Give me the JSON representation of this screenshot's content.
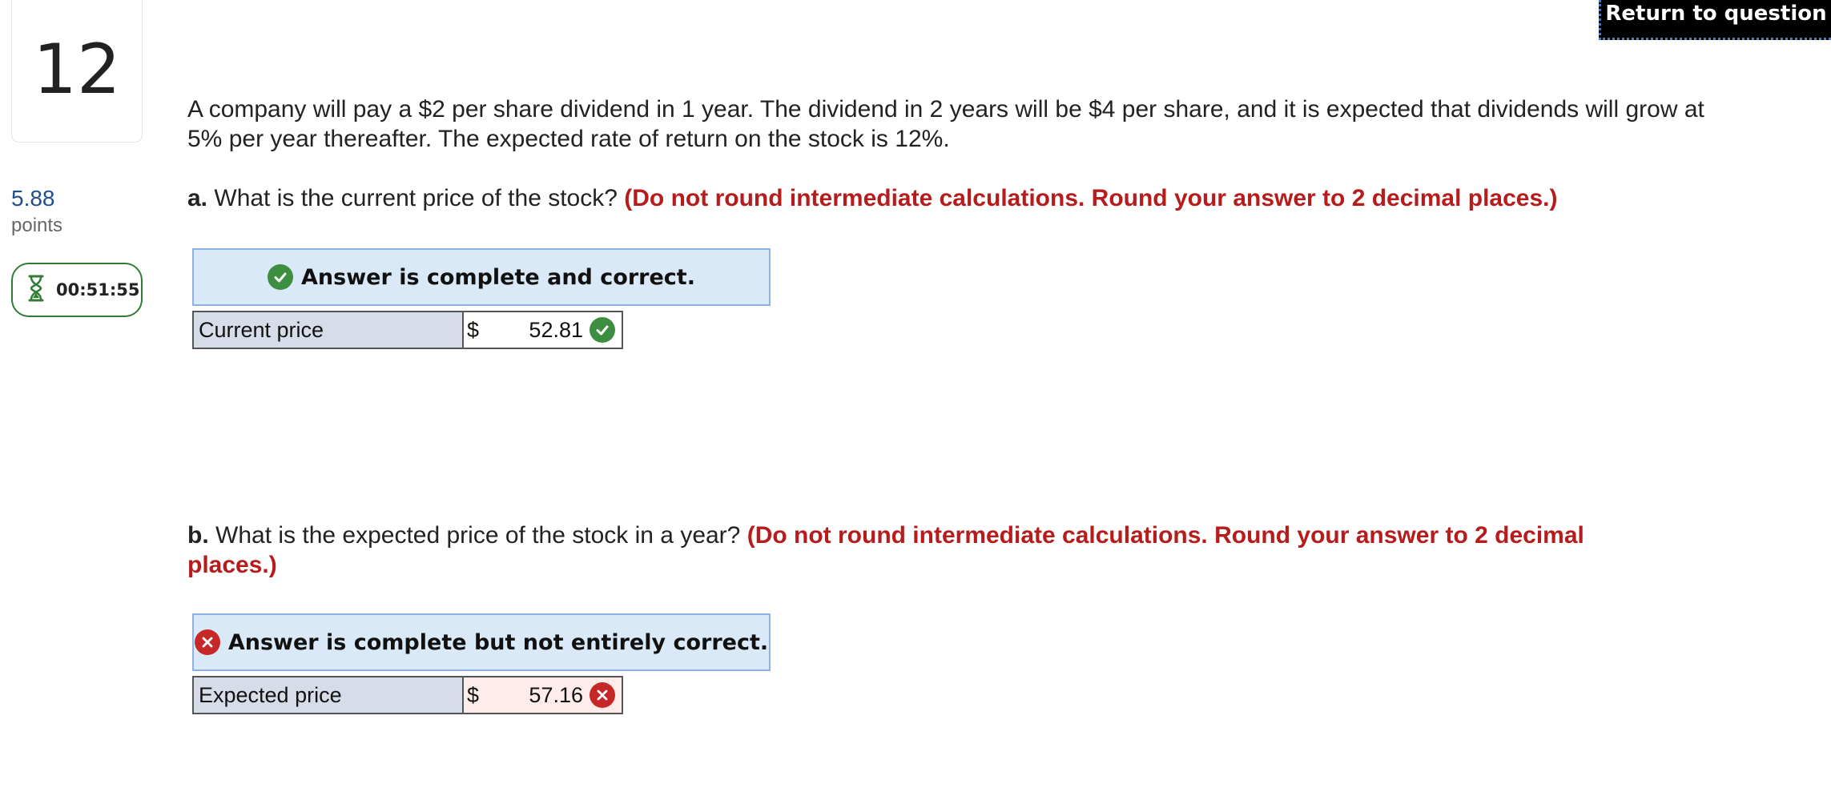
{
  "header": {
    "return_label": "Return to question"
  },
  "question": {
    "number": "12",
    "points_value": "5.88",
    "points_label": "points",
    "timer": "00:51:55",
    "prompt": "A company will pay a $2 per share dividend in 1 year. The dividend in 2 years will be $4 per share, and it is expected that dividends will grow at 5% per year thereafter. The expected rate of return on the stock is 12%."
  },
  "part_a": {
    "letter": "a.",
    "question": "What is the current price of the stock?",
    "note": "(Do not round intermediate calculations. Round your answer to 2 decimal places.)",
    "status": "Answer is complete and correct.",
    "status_icon": "check-circle-icon",
    "row_label": "Current price",
    "currency": "$",
    "value": "52.81",
    "value_icon": "check-circle-icon"
  },
  "part_b": {
    "letter": "b.",
    "question": "What is the expected price of the stock in a year?",
    "note": "(Do not round intermediate calculations. Round your answer to 2 decimal places.)",
    "status": "Answer is complete but not entirely correct.",
    "status_icon": "x-circle-icon",
    "row_label": "Expected price",
    "currency": "$",
    "value": "57.16",
    "value_icon": "x-circle-icon"
  },
  "colors": {
    "correct": "#3e8e41",
    "incorrect": "#c62828",
    "instruction": "#b71c1c",
    "banner_bg": "#d9e9f7",
    "label_bg": "#d6dce8"
  }
}
